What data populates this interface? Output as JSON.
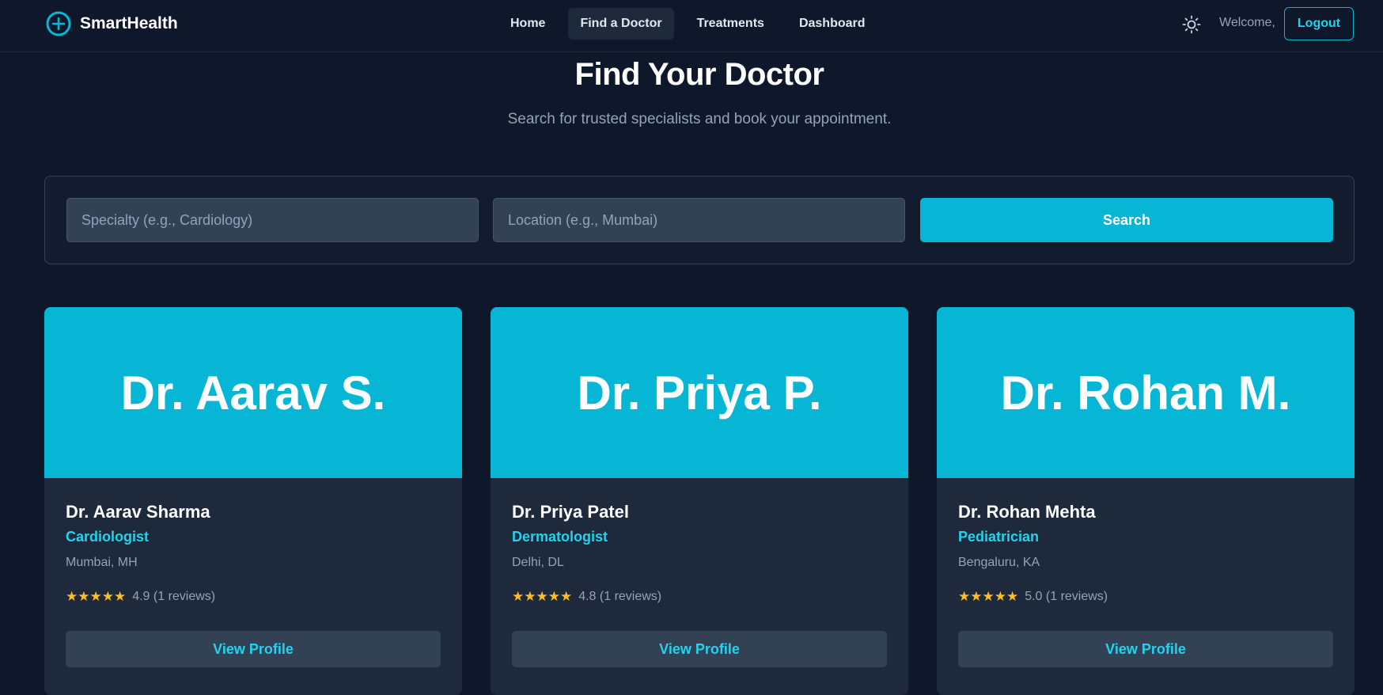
{
  "nav": {
    "brand": "SmartHealth",
    "brand_icon": "plus-circle-icon",
    "links": [
      "Home",
      "Find a Doctor",
      "Treatments",
      "Dashboard"
    ],
    "active_link": "Find a Doctor",
    "theme_icon": "sun-icon",
    "welcome": "Welcome,",
    "logout": "Logout"
  },
  "header": {
    "title": "Find Your Doctor",
    "subtitle": "Search for trusted specialists and book your appointment."
  },
  "search": {
    "specialty_placeholder": "Specialty (e.g., Cardiology)",
    "specialty_value": "",
    "location_placeholder": "Location (e.g., Mumbai)",
    "location_value": "",
    "button": "Search"
  },
  "doctors": [
    {
      "banner": "Dr. Aarav S.",
      "name": "Dr. Aarav Sharma",
      "specialty": "Cardiologist",
      "location": "Mumbai, MH",
      "stars": "★★★★★",
      "rating": "4.9 (1 reviews)",
      "button": "View Profile"
    },
    {
      "banner": "Dr. Priya P.",
      "name": "Dr. Priya Patel",
      "specialty": "Dermatologist",
      "location": "Delhi, DL",
      "stars": "★★★★★",
      "rating": "4.8 (1 reviews)",
      "button": "View Profile"
    },
    {
      "banner": "Dr. Rohan M.",
      "name": "Dr. Rohan Mehta",
      "specialty": "Pediatrician",
      "location": "Bengaluru, KA",
      "stars": "★★★★★",
      "rating": "5.0 (1 reviews)",
      "button": "View Profile"
    }
  ],
  "colors": {
    "background": "#0f172a",
    "surface": "#1e293b",
    "accent": "#06b6d4",
    "accent_text": "#22d3ee",
    "star": "#fbbf24"
  }
}
